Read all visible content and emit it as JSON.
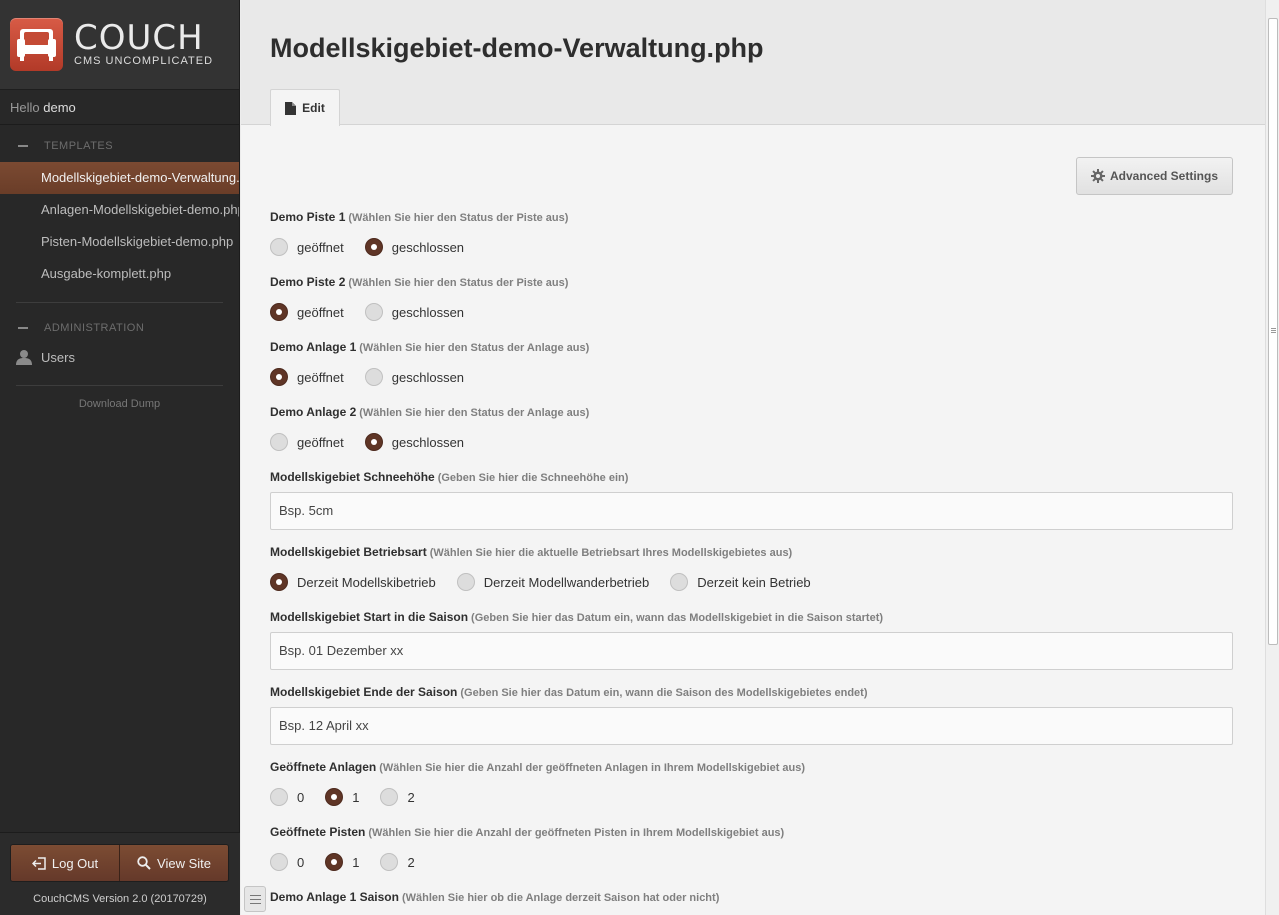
{
  "brand": {
    "name": "COUCH",
    "tagline": "CMS UNCOMPLICATED"
  },
  "hello": {
    "prefix": "Hello",
    "user": "demo"
  },
  "sidebar": {
    "templates_header": "TEMPLATES",
    "templates": [
      {
        "label": "Modellskigebiet-demo-Verwaltung.php",
        "active": true
      },
      {
        "label": "Anlagen-Modellskigebiet-demo.php",
        "active": false
      },
      {
        "label": "Pisten-Modellskigebiet-demo.php",
        "active": false
      },
      {
        "label": "Ausgabe-komplett.php",
        "active": false
      }
    ],
    "admin_header": "ADMINISTRATION",
    "users_label": "Users",
    "dump_label": "Download Dump",
    "logout_label": "Log Out",
    "viewsite_label": "View Site",
    "version": "CouchCMS Version 2.0 (20170729)"
  },
  "page": {
    "title": "Modellskigebiet-demo-Verwaltung.php",
    "tab_edit": "Edit",
    "advanced_settings": "Advanced Settings"
  },
  "fields": {
    "piste1": {
      "label": "Demo Piste 1",
      "hint": "(Wählen Sie hier den Status der Piste aus)",
      "options": [
        "geöffnet",
        "geschlossen"
      ],
      "selected": "geschlossen"
    },
    "piste2": {
      "label": "Demo Piste 2",
      "hint": "(Wählen Sie hier den Status der Piste aus)",
      "options": [
        "geöffnet",
        "geschlossen"
      ],
      "selected": "geöffnet"
    },
    "anlage1": {
      "label": "Demo Anlage 1",
      "hint": "(Wählen Sie hier den Status der Anlage aus)",
      "options": [
        "geöffnet",
        "geschlossen"
      ],
      "selected": "geöffnet"
    },
    "anlage2": {
      "label": "Demo Anlage 2",
      "hint": "(Wählen Sie hier den Status der Anlage aus)",
      "options": [
        "geöffnet",
        "geschlossen"
      ],
      "selected": "geschlossen"
    },
    "schneehoehe": {
      "label": "Modellskigebiet Schneehöhe",
      "hint": "(Geben Sie hier die Schneehöhe ein)",
      "value": "Bsp. 5cm"
    },
    "betriebsart": {
      "label": "Modellskigebiet Betriebsart",
      "hint": "(Wählen Sie hier die aktuelle Betriebsart Ihres Modellskigebietes aus)",
      "options": [
        "Derzeit Modellskibetrieb",
        "Derzeit Modellwanderbetrieb",
        "Derzeit kein Betrieb"
      ],
      "selected": "Derzeit Modellskibetrieb"
    },
    "start": {
      "label": "Modellskigebiet Start in die Saison",
      "hint": "(Geben Sie hier das Datum ein, wann das Modellskigebiet in die Saison startet)",
      "value": "Bsp. 01 Dezember xx"
    },
    "ende": {
      "label": "Modellskigebiet Ende der Saison",
      "hint": "(Geben Sie hier das Datum ein, wann die Saison des Modellskigebietes endet)",
      "value": "Bsp. 12 April xx"
    },
    "anlagen_offen": {
      "label": "Geöffnete Anlagen",
      "hint": "(Wählen Sie hier die Anzahl der geöffneten Anlagen in Ihrem Modellskigebiet aus)",
      "options": [
        "0",
        "1",
        "2"
      ],
      "selected": "1"
    },
    "pisten_offen": {
      "label": "Geöffnete Pisten",
      "hint": "(Wählen Sie hier die Anzahl der geöffneten Pisten in Ihrem Modellskigebiet aus)",
      "options": [
        "0",
        "1",
        "2"
      ],
      "selected": "1"
    },
    "anlage1_saison": {
      "label": "Demo Anlage 1 Saison",
      "hint": "(Wählen Sie hier ob die Anlage derzeit Saison hat oder nicht)"
    }
  },
  "colors": {
    "accent": "#6a3d28",
    "radio_checked": "#5f3526",
    "sidebar_bg": "#282828"
  }
}
